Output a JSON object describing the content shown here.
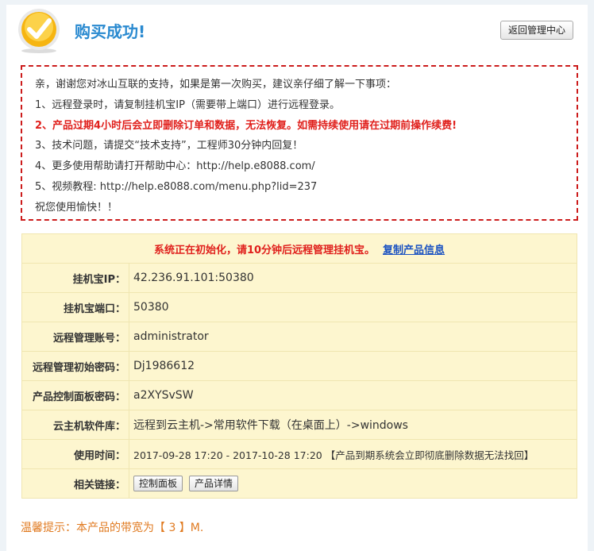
{
  "header": {
    "title": "购买成功!",
    "back_button": "返回管理中心"
  },
  "notice": {
    "lines": [
      "亲，谢谢您对冰山互联的支持，如果是第一次购买，建议亲仔细了解一下事项：",
      "1、远程登录时，请复制挂机宝IP（需要带上端口）进行远程登录。",
      "2、产品过期4小时后会立即删除订单和数据，无法恢复。如需持续使用请在过期前操作续费!",
      "3、技术问题，请提交“技术支持”，工程师30分钟内回复！",
      "4、更多使用帮助请打开帮助中心：http://help.e8088.com/",
      "5、视频教程: http://help.e8088.com/menu.php?lid=237",
      "祝您使用愉快！！"
    ]
  },
  "status": {
    "text": "系统正在初始化，请10分钟后远程管理挂机宝。",
    "copy_link": "复制产品信息"
  },
  "rows": [
    {
      "label": "挂机宝IP：",
      "value": "42.236.91.101:50380"
    },
    {
      "label": "挂机宝端口：",
      "value": "50380"
    },
    {
      "label": "远程管理账号：",
      "value": "administrator"
    },
    {
      "label": "远程管理初始密码：",
      "value": "Dj1986612"
    },
    {
      "label": "产品控制面板密码：",
      "value": "a2XYSvSW"
    },
    {
      "label": "云主机软件库：",
      "value": "远程到云主机->常用软件下载（在桌面上）->windows"
    },
    {
      "label": "使用时间：",
      "value": "2017-09-28 17:20 - 2017-10-28 17:20 【产品到期系统会立即彻底删除数据无法找回】"
    }
  ],
  "links_row": {
    "label": "相关链接：",
    "control_panel": "控制面板",
    "product_detail": "产品详情"
  },
  "tip": "温馨提示：本产品的带宽为【 3 】M.",
  "colors": {
    "title": "#2a8ad0",
    "warning": "#e0201c",
    "link": "#1a52c2",
    "table_bg": "#fdf6cf",
    "tip": "#e07a20"
  }
}
